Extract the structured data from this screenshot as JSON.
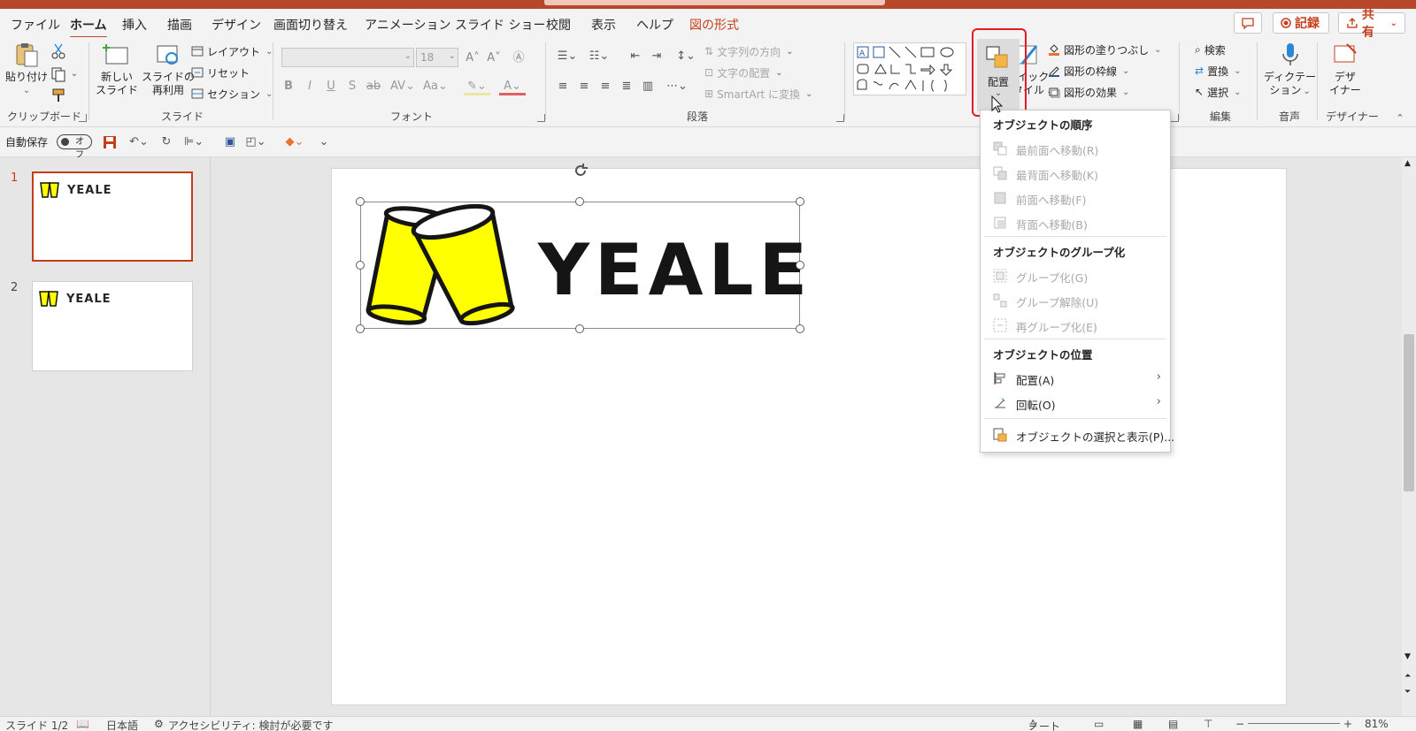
{
  "tabs": {
    "file": "ファイル",
    "home": "ホーム",
    "insert": "挿入",
    "draw": "描画",
    "design": "デザイン",
    "transitions": "画面切り替え",
    "animations": "アニメーション",
    "slideshow": "スライド ショー",
    "review": "校閲",
    "view": "表示",
    "help": "ヘルプ",
    "shape_format": "図の形式"
  },
  "title_actions": {
    "record": "記録",
    "share": "共有"
  },
  "ribbon": {
    "clipboard": {
      "paste": "貼り付け",
      "label": "クリップボード"
    },
    "slides": {
      "new_slide_1": "新しい",
      "new_slide_2": "スライド",
      "reuse_1": "スライドの",
      "reuse_2": "再利用",
      "layout": "レイアウト",
      "reset": "リセット",
      "section": "セクション",
      "label": "スライド"
    },
    "font": {
      "size": "18",
      "label": "フォント"
    },
    "paragraph": {
      "text_direction": "文字列の方向",
      "align_text": "文字の配置",
      "smartart": "SmartArt に変換",
      "label": "段落"
    },
    "drawing": {
      "arrange": "配置",
      "quick_styles_1": "クイック",
      "quick_styles_2": "スタイル",
      "fill": "図形の塗りつぶし",
      "outline": "図形の枠線",
      "effects": "図形の効果"
    },
    "editing": {
      "find": "検索",
      "replace": "置換",
      "select": "選択",
      "label": "編集"
    },
    "voice": {
      "dictate_1": "ディクテー",
      "dictate_2": "ション",
      "label": "音声"
    },
    "designer": {
      "btn_1": "デザ",
      "btn_2": "イナー",
      "label": "デザイナー"
    }
  },
  "qat": {
    "autosave": "自動保存",
    "toggle": "オフ"
  },
  "thumbnails": [
    {
      "num": "1",
      "text": "YEALE"
    },
    {
      "num": "2",
      "text": "YEALE"
    }
  ],
  "slide": {
    "logo_text": "YEALE"
  },
  "arrange_menu": {
    "order_header": "オブジェクトの順序",
    "bring_front": "最前面へ移動(R)",
    "send_back": "最背面へ移動(K)",
    "bring_forward": "前面へ移動(F)",
    "send_backward": "背面へ移動(B)",
    "group_header": "オブジェクトのグループ化",
    "group": "グループ化(G)",
    "ungroup": "グループ解除(U)",
    "regroup": "再グループ化(E)",
    "position_header": "オブジェクトの位置",
    "align": "配置(A)",
    "rotate": "回転(O)",
    "selection_pane": "オブジェクトの選択と表示(P)..."
  },
  "status": {
    "slide": "スライド 1/2",
    "lang": "日本語",
    "accessibility": "アクセシビリティ: 検討が必要です",
    "notes": "ノート",
    "zoom": "81%"
  },
  "colors": {
    "accent": "#b7472a",
    "highlight": "#e31b23",
    "logo_yellow": "#ffff00"
  }
}
